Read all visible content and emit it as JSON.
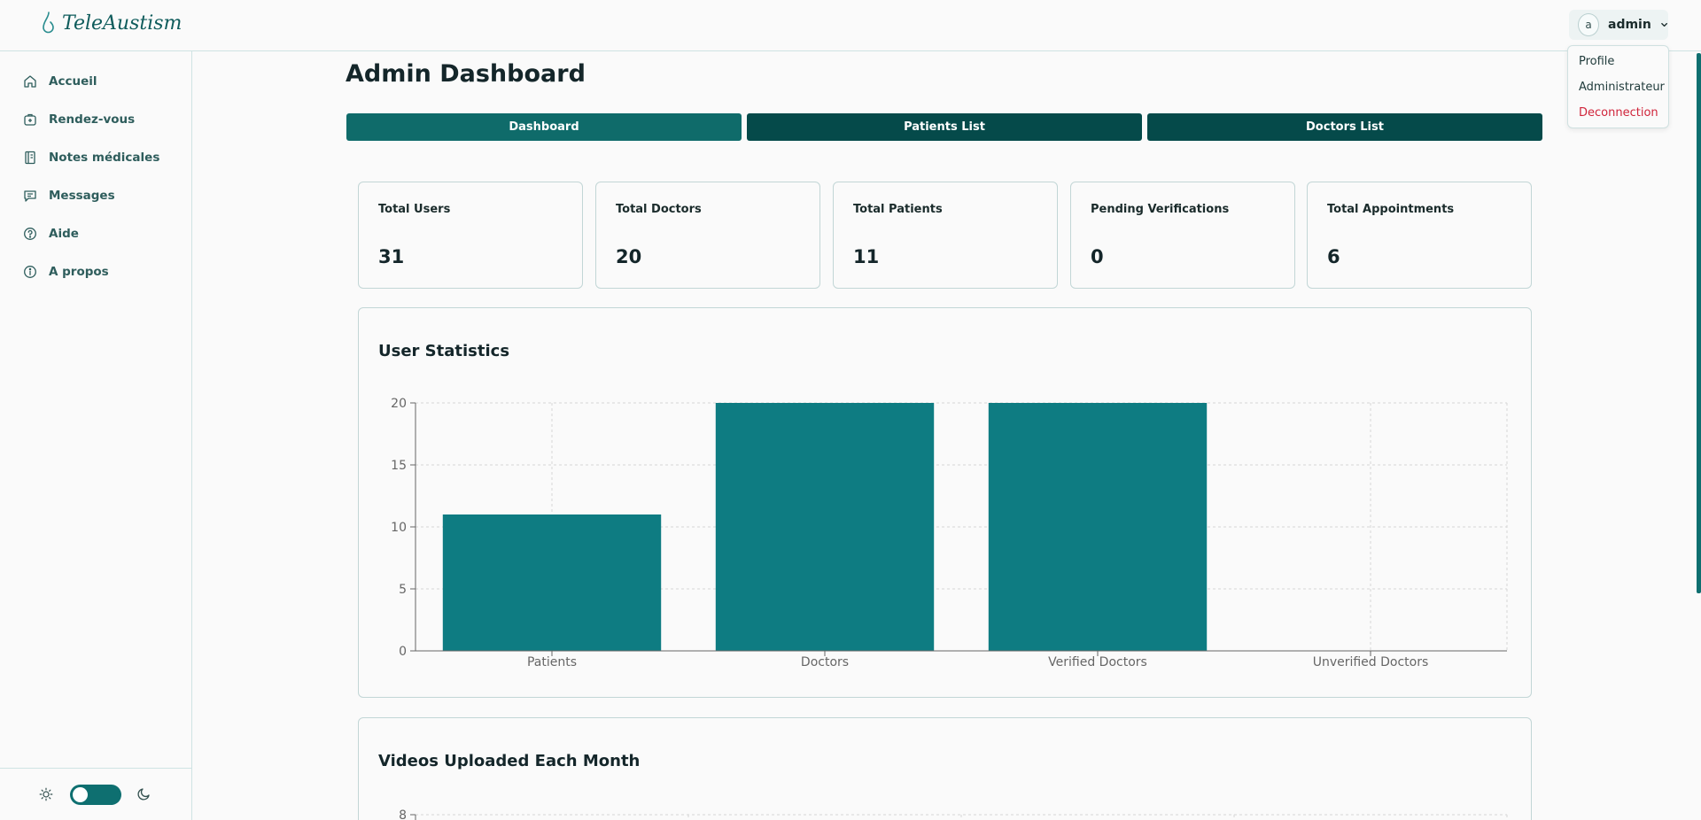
{
  "app": {
    "name": "TeleAustism"
  },
  "user_menu": {
    "avatar_initial": "a",
    "username": "admin",
    "items": [
      {
        "label": "Profile"
      },
      {
        "label": "Administrateur"
      },
      {
        "label": "Deconnection"
      }
    ]
  },
  "sidebar": {
    "items": [
      {
        "label": "Accueil",
        "icon": "home-icon"
      },
      {
        "label": "Rendez-vous",
        "icon": "calendar-bag-icon"
      },
      {
        "label": "Notes médicales",
        "icon": "notebook-icon"
      },
      {
        "label": "Messages",
        "icon": "message-icon"
      },
      {
        "label": "Aide",
        "icon": "help-circle-icon"
      },
      {
        "label": "A propos",
        "icon": "info-circle-icon"
      }
    ],
    "theme_toggle": {
      "mode": "light"
    }
  },
  "main": {
    "title": "Admin Dashboard",
    "tabs": [
      {
        "label": "Dashboard",
        "active": true
      },
      {
        "label": "Patients List",
        "active": false
      },
      {
        "label": "Doctors List",
        "active": false
      }
    ],
    "stats": [
      {
        "label": "Total Users",
        "value": "31"
      },
      {
        "label": "Total Doctors",
        "value": "20"
      },
      {
        "label": "Total Patients",
        "value": "11"
      },
      {
        "label": "Pending Verifications",
        "value": "0"
      },
      {
        "label": "Total Appointments",
        "value": "6"
      }
    ],
    "user_statistics_title": "User Statistics",
    "videos_title": "Videos Uploaded Each Month"
  },
  "colors": {
    "accent": "#0e7c82",
    "tab_active": "#0f6b6a",
    "tab_inactive": "#054a4a",
    "danger": "#d0243a"
  },
  "chart_data": [
    {
      "type": "bar",
      "title": "User Statistics",
      "categories": [
        "Patients",
        "Doctors",
        "Verified Doctors",
        "Unverified Doctors"
      ],
      "values": [
        11,
        20,
        20,
        0
      ],
      "ylim": [
        0,
        20
      ],
      "yticks": [
        0,
        5,
        10,
        15,
        20
      ],
      "grid": true,
      "xlabel": "",
      "ylabel": ""
    },
    {
      "type": "bar",
      "title": "Videos Uploaded Each Month",
      "yticks": [
        8
      ],
      "grid": true
    }
  ]
}
